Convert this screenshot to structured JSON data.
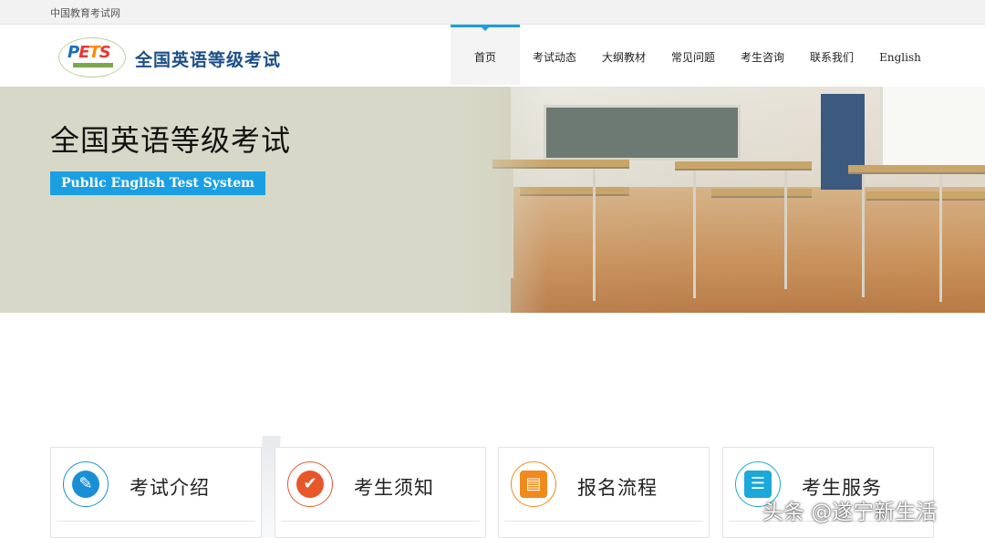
{
  "topbar": {
    "site_link": "中国教育考试网"
  },
  "header": {
    "logo": {
      "letters": [
        "P",
        "E",
        "T",
        "S"
      ],
      "text": "全国英语等级考试"
    },
    "nav": [
      {
        "label": "首页",
        "active": true
      },
      {
        "label": "考试动态",
        "active": false
      },
      {
        "label": "大纲教材",
        "active": false
      },
      {
        "label": "常见问题",
        "active": false
      },
      {
        "label": "考生咨询",
        "active": false
      },
      {
        "label": "联系我们",
        "active": false
      },
      {
        "label": "English",
        "active": false
      }
    ]
  },
  "hero": {
    "title": "全国英语等级考试",
    "tag": "Public English Test System"
  },
  "cards": [
    {
      "title": "考试介绍",
      "icon": "document-edit-icon",
      "color": "#1a8fd6"
    },
    {
      "title": "考生须知",
      "icon": "checkmark-icon",
      "color": "#e8572a"
    },
    {
      "title": "报名流程",
      "icon": "browser-edit-icon",
      "color": "#f08a1c"
    },
    {
      "title": "考生服务",
      "icon": "contact-book-icon",
      "color": "#1aa9d8"
    }
  ],
  "watermark": "头条 @遂宁新生活",
  "colors": {
    "accent": "#1aa0e2",
    "title_blue": "#1c4f8a"
  }
}
